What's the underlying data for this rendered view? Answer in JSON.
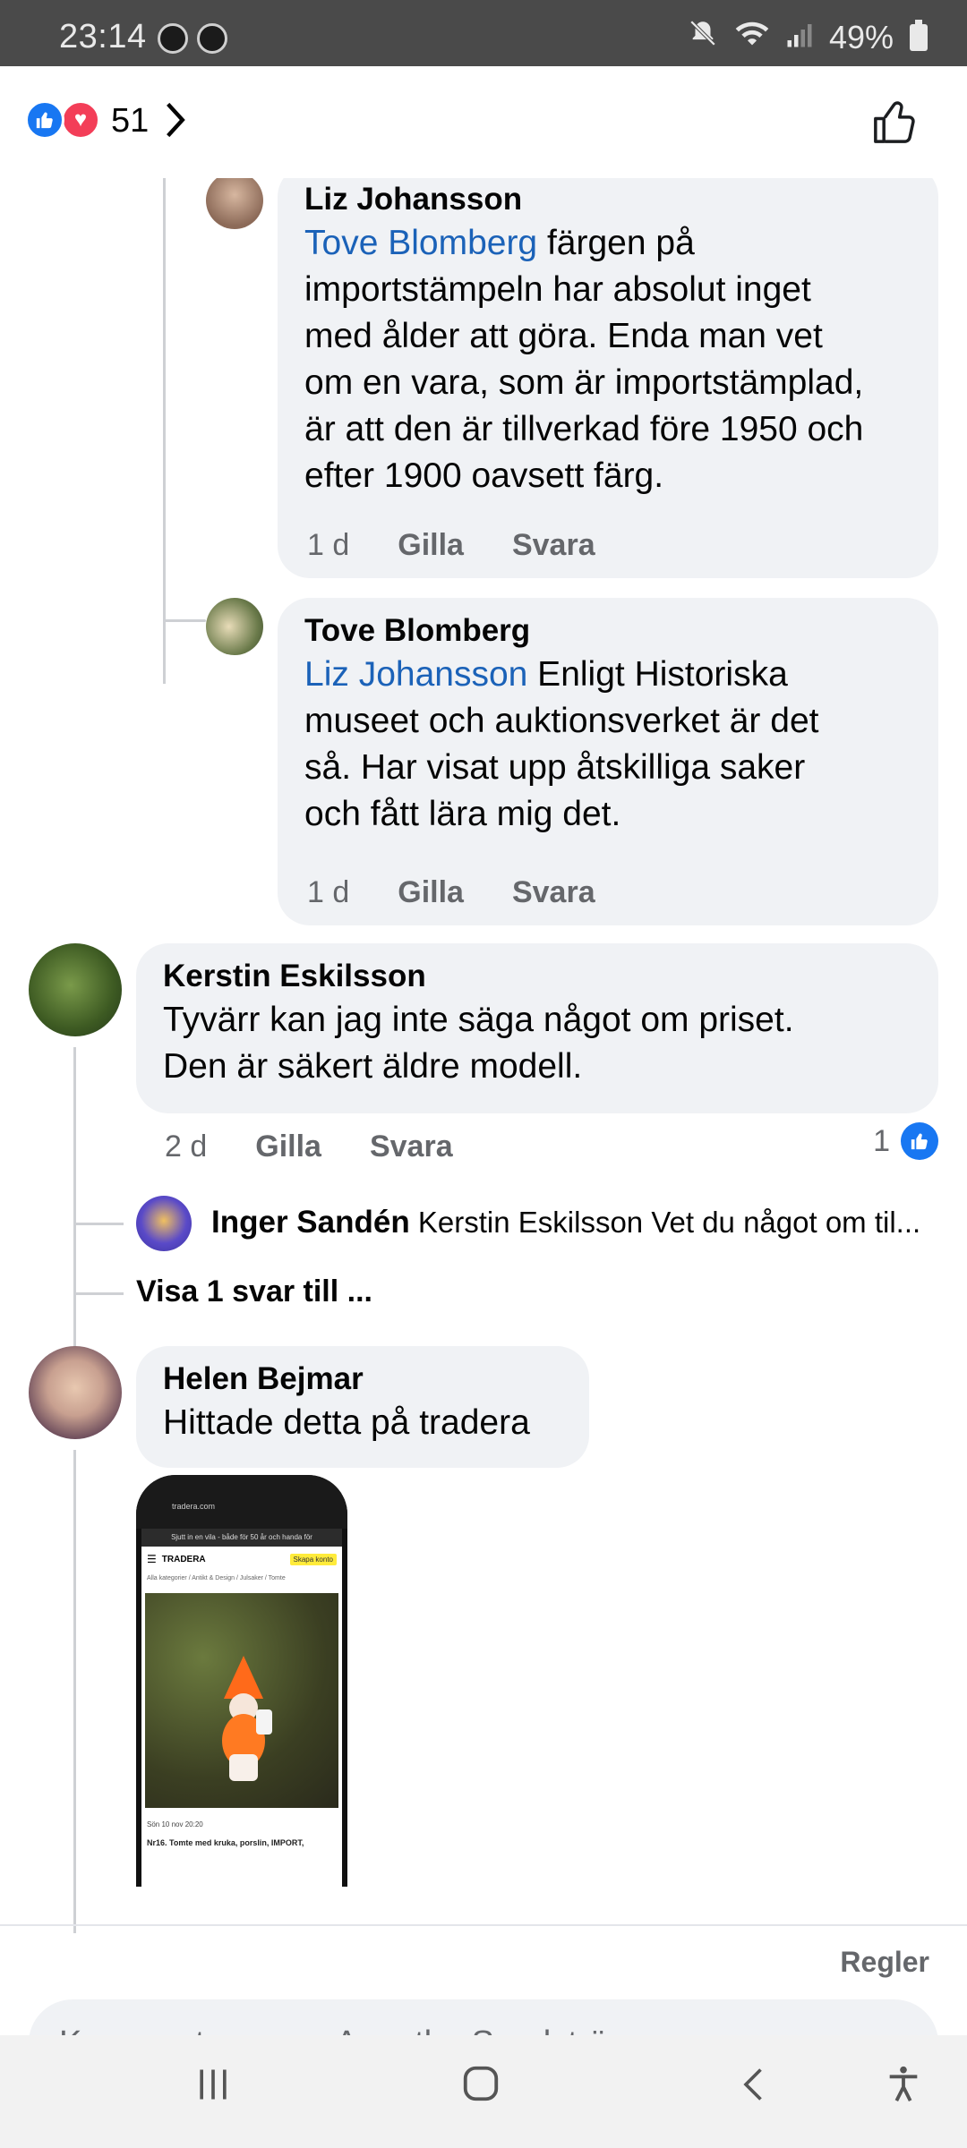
{
  "status_bar": {
    "time": "23:14",
    "battery": "49%"
  },
  "reactions": {
    "count": "51"
  },
  "comments": [
    {
      "author": "Liz Johansson",
      "mention": "Tove Blomberg",
      "text_lines": [
        " färgen på",
        "importstämpeln har absolut inget",
        "med ålder att göra. Enda man vet",
        "om en vara, som är importstämplad,",
        "är att den är tillverkad före 1950 och",
        "efter 1900 oavsett färg."
      ],
      "time": "1 d",
      "like_label": "Gilla",
      "reply_label": "Svara"
    },
    {
      "author": "Tove Blomberg",
      "mention": "Liz Johansson",
      "text_lines": [
        " Enligt Historiska",
        "museet och auktionsverket är det",
        "så. Har visat upp åtskilliga saker",
        "och fått lära mig det."
      ],
      "time": "1 d",
      "like_label": "Gilla",
      "reply_label": "Svara"
    },
    {
      "author": "Kerstin Eskilsson",
      "text_lines": [
        "Tyvärr kan jag inte säga något om priset.",
        "Den är säkert äldre modell."
      ],
      "time": "2 d",
      "like_label": "Gilla",
      "reply_label": "Svara",
      "like_count": "1",
      "reply_preview": {
        "author": "Inger Sandén",
        "text": "Kerstin Eskilsson Vet du något om til..."
      },
      "more_replies": "Visa 1 svar till ..."
    },
    {
      "author": "Helen Bejmar",
      "text": "Hittade detta på tradera",
      "attachment": {
        "site": "tradera.com",
        "ad_text": "Sjutt in en vila - både för 50 år och handa för",
        "brand": "TRADERA",
        "signup": "Skapa konto",
        "crumbs": "Alla kategorier / Antikt & Design / Julsaker / Tomte",
        "date": "Sön 10 nov 20:20",
        "title": "Nr16. Tomte med kruka, porslin, IMPORT,"
      }
    }
  ],
  "footer": {
    "rules": "Regler",
    "input_placeholder": "Kommentera som Agnetha Sandström"
  },
  "colors": {
    "accent": "#1877f2",
    "love": "#f33e58",
    "mention": "#1b62b8",
    "bubble": "#f0f2f5"
  }
}
